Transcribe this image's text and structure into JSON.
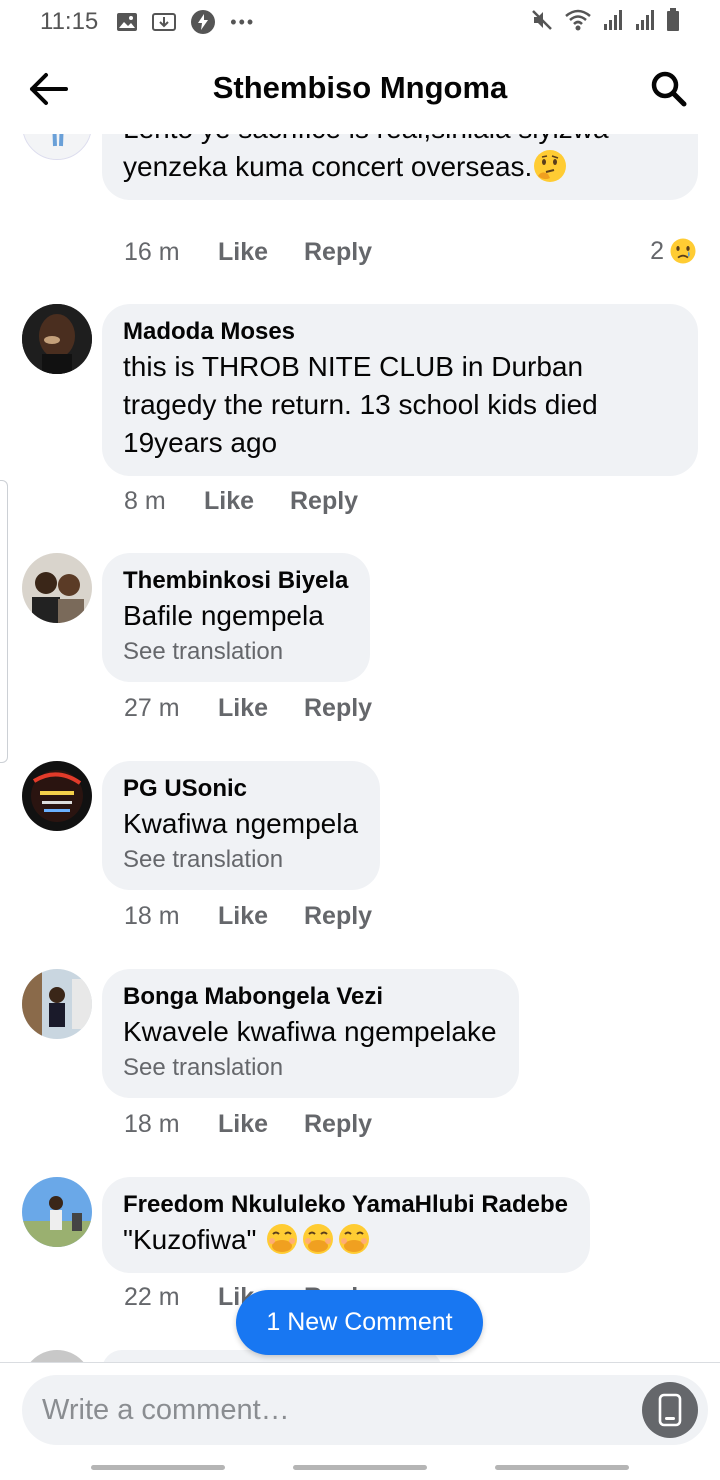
{
  "status_bar": {
    "time": "11:15",
    "dots": "•••"
  },
  "header": {
    "title": "Sthembiso Mngoma"
  },
  "comments": [
    {
      "author": "",
      "text": "Lento ye sacrifice is real,sihlala siyizwa yenzeka kuma concert overseas.",
      "emoji": "thinking-face",
      "time": "16 m",
      "like": "Like",
      "reply": "Reply",
      "reaction_count": "2",
      "reaction": "sad-face"
    },
    {
      "author": "Madoda Moses",
      "text": "this is THROB NITE CLUB in Durban tragedy the return. 13 school kids died 19years ago",
      "time": "8 m",
      "like": "Like",
      "reply": "Reply"
    },
    {
      "author": "Thembinkosi Biyela",
      "text": "Bafile ngempela",
      "translate": "See translation",
      "time": "27 m",
      "like": "Like",
      "reply": "Reply"
    },
    {
      "author": "PG USonic",
      "text": "Kwafiwa ngempela",
      "translate": "See translation",
      "time": "18 m",
      "like": "Like",
      "reply": "Reply"
    },
    {
      "author": "Bonga Mabongela Vezi",
      "text": "Kwavele kwafiwa ngempelake",
      "translate": "See translation",
      "time": "18 m",
      "like": "Like",
      "reply": "Reply"
    },
    {
      "author": "Freedom Nkululeko YamaHlubi Radebe",
      "text": "\"Kuzofiwa\"",
      "emoji": "face-with-hand-over-mouth x3",
      "time": "22 m",
      "like": "Like",
      "reply": "Reply"
    }
  ],
  "new_comment_pill": "1 New Comment",
  "composer": {
    "placeholder": "Write a comment…"
  },
  "colors": {
    "accent": "#1877f2",
    "bubble": "#f0f2f5",
    "secondary_text": "#65676b"
  }
}
